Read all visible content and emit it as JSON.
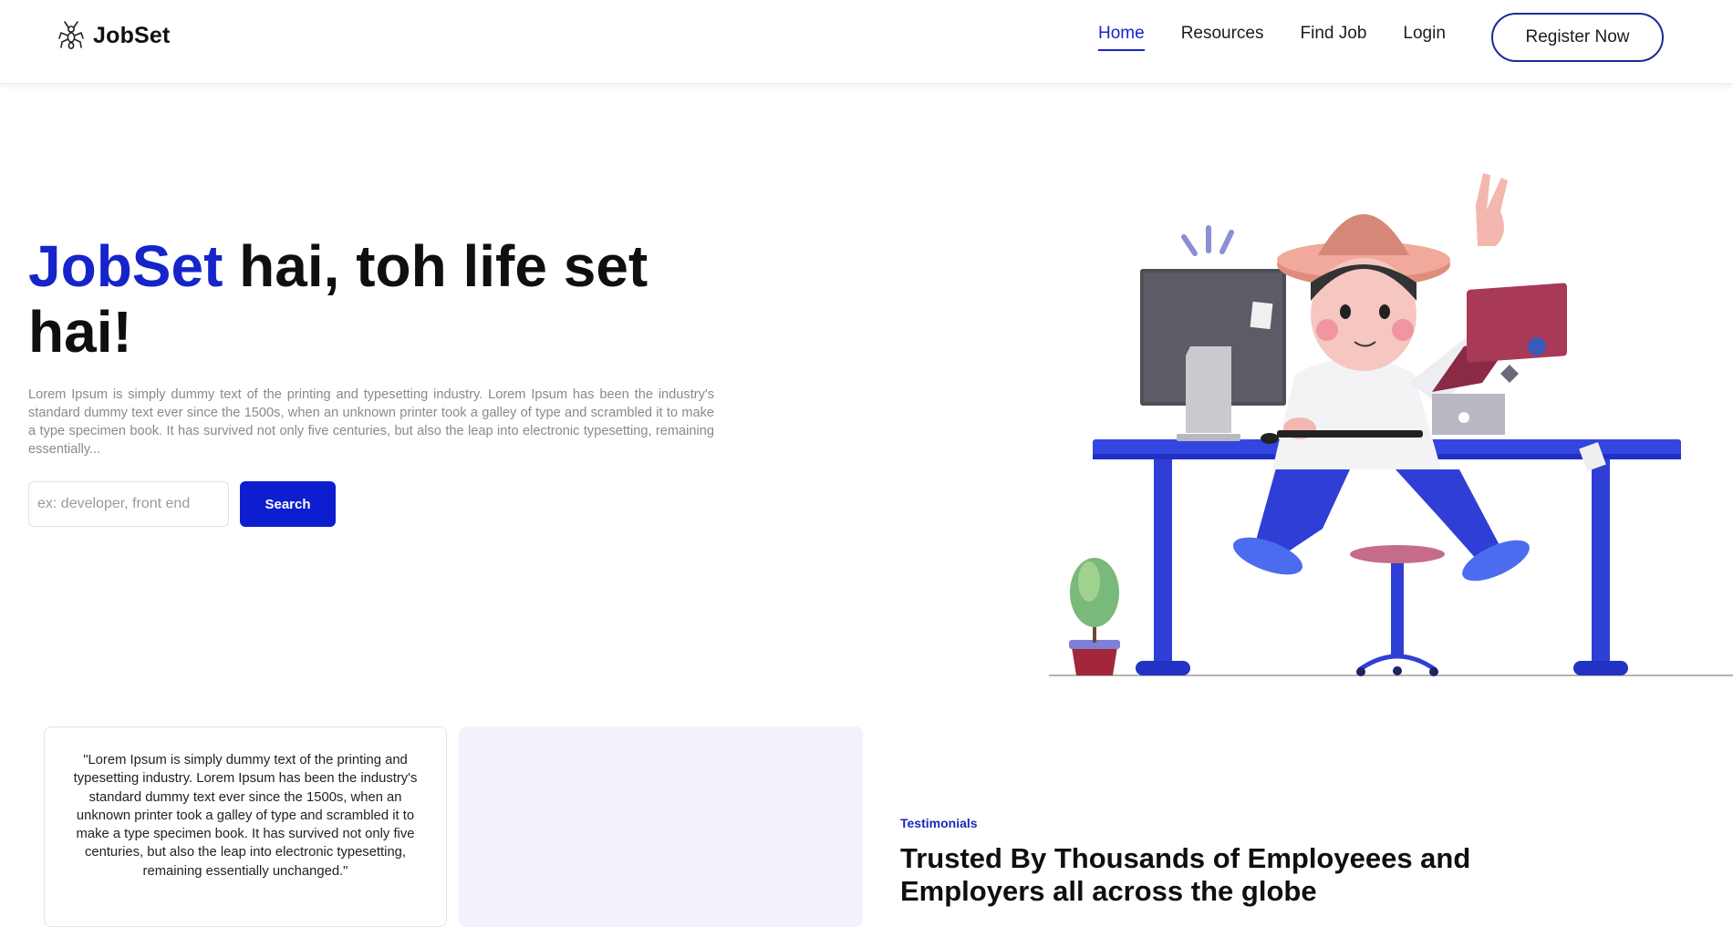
{
  "brand": {
    "name": "JobSet",
    "logo_icon": "ant-icon"
  },
  "nav": {
    "items": [
      {
        "label": "Home",
        "active": true
      },
      {
        "label": "Resources",
        "active": false
      },
      {
        "label": "Find Job",
        "active": false
      },
      {
        "label": "Login",
        "active": false
      }
    ],
    "register_label": "Register Now"
  },
  "hero": {
    "title_brand": "JobSet",
    "title_rest": " hai, toh life set hai!",
    "description": "Lorem Ipsum is simply dummy text of the printing and typesetting industry. Lorem Ipsum has been the industry's standard dummy text ever since the 1500s, when an unknown printer took a galley of type and scrambled it to make a type specimen book. It has survived not only five centuries, but also the leap into electronic typesetting, remaining essentially...",
    "search_placeholder": "ex: developer, front end",
    "search_value": "",
    "search_button": "Search"
  },
  "testimonials": {
    "quote": "\"Lorem Ipsum is simply dummy text of the printing and typesetting industry. Lorem Ipsum has been the industry's standard dummy text ever since the 1500s, when an unknown printer took a galley of type and scrambled it to make a type specimen book. It has survived not only five centuries, but also the leap into electronic typesetting, remaining essentially unchanged.\"",
    "label": "Testimonials",
    "heading": "Trusted By Thousands of Employeees and Employers all across the globe"
  },
  "colors": {
    "accent": "#1525c9",
    "button": "#0d1ed1",
    "desk": "#2f3fd6",
    "card_bg": "#f2f2fc"
  }
}
